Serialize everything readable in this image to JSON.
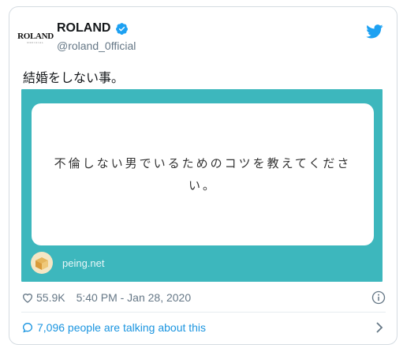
{
  "author": {
    "display_name": "ROLAND",
    "handle": "@roland_0fficial",
    "avatar_text": "ROLAND",
    "avatar_subtext": "OFFICIAL",
    "verified": true
  },
  "tweet": {
    "text": "結婚をしない事。"
  },
  "media": {
    "question_line1": "不倫しない男でいるためのコツを教えてくださ",
    "question_line2": "い。",
    "source": "peing.net",
    "bg_color": "#3db7bd"
  },
  "meta": {
    "likes": "55.9K",
    "timestamp": "5:40 PM - Jan 28, 2020"
  },
  "footer": {
    "talking": "7,096 people are talking about this"
  },
  "colors": {
    "accent": "#1da1f2",
    "muted": "#657786",
    "link": "#1b95e0"
  },
  "icons": [
    "verified-icon",
    "twitter-bird-icon",
    "heart-icon",
    "info-icon",
    "speech-bubble-icon",
    "chevron-right-icon"
  ]
}
